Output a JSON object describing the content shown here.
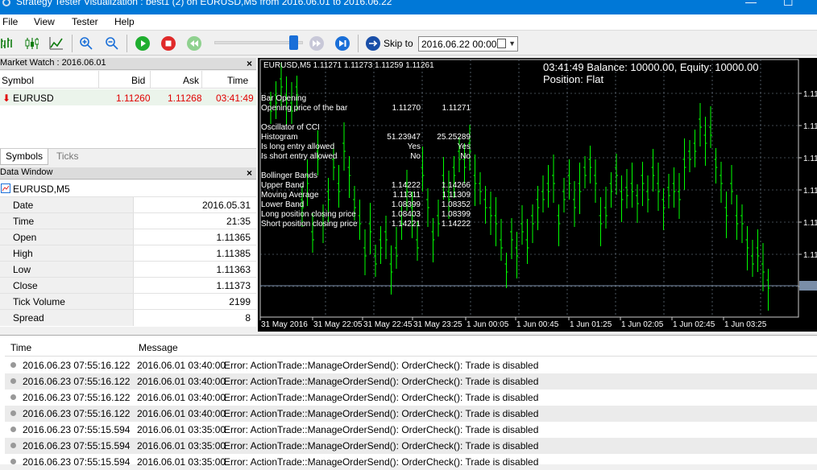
{
  "window": {
    "title": "Strategy Tester Visualization : best1 (2) on EURUSD,M5 from 2016.06.01 to 2016.06.22"
  },
  "menu": [
    "File",
    "View",
    "Tester",
    "Help"
  ],
  "toolbar": {
    "skip_label": "Skip to",
    "skip_date": "2016.06.22 00:00",
    "speed_level": 0.88
  },
  "market_watch": {
    "title": "Market Watch : 2016.06.01",
    "headers": {
      "symbol": "Symbol",
      "bid": "Bid",
      "ask": "Ask",
      "time": "Time"
    },
    "row": {
      "symbol": "EURUSD",
      "bid": "1.11260",
      "ask": "1.11268",
      "time": "03:41:49"
    },
    "tabs": [
      "Symbols",
      "Ticks"
    ]
  },
  "data_window": {
    "title": "Data Window",
    "symbol": "EURUSD,M5",
    "rows": [
      {
        "k": "Date",
        "v": "2016.05.31"
      },
      {
        "k": "Time",
        "v": "21:35"
      },
      {
        "k": "Open",
        "v": "1.11365"
      },
      {
        "k": "High",
        "v": "1.11385"
      },
      {
        "k": "Low",
        "v": "1.11363"
      },
      {
        "k": "Close",
        "v": "1.11373"
      },
      {
        "k": "Tick Volume",
        "v": "2199"
      },
      {
        "k": "Spread",
        "v": "8"
      }
    ]
  },
  "chart": {
    "header": "EURUSD,M5  1.11271 1.11273 1.11259 1.11261",
    "balance": "03:41:49 Balance: 10000.00, Equity: 10000.00",
    "position": "Position: Flat",
    "info": [
      {
        "label": "Bar Opening",
        "v1": "",
        "v2": ""
      },
      {
        "label": "Opening price of the bar",
        "v1": "1.11270",
        "v2": "1.11271"
      },
      {
        "label": "",
        "v1": "",
        "v2": ""
      },
      {
        "label": "Oscillator of CCI",
        "v1": "",
        "v2": ""
      },
      {
        "label": "Histogram",
        "v1": "51.23947",
        "v2": "25.25289"
      },
      {
        "label": "Is long entry allowed",
        "v1": "Yes",
        "v2": "Yes"
      },
      {
        "label": "Is short entry allowed",
        "v1": "No",
        "v2": "No"
      },
      {
        "label": "",
        "v1": "",
        "v2": ""
      },
      {
        "label": "Bollinger Bands",
        "v1": "",
        "v2": ""
      },
      {
        "label": "Upper Band",
        "v1": "1.14222",
        "v2": "1.14266"
      },
      {
        "label": "Moving Average",
        "v1": "1.11311",
        "v2": "1.11309"
      },
      {
        "label": "Lower Band",
        "v1": "1.08399",
        "v2": "1.08352"
      },
      {
        "label": "Long position closing price",
        "v1": "1.08403",
        "v2": "1.08399"
      },
      {
        "label": "Short position closing price",
        "v1": "1.14221",
        "v2": "1.14222"
      }
    ],
    "price_ticks": [
      "1.11",
      "1.11",
      "1.11",
      "1.11",
      "1.11",
      "1.11",
      "1.11",
      "1.11"
    ],
    "time_ticks": [
      "31 May 2016",
      "31 May 22:05",
      "31 May 22:45",
      "31 May 23:25",
      "1 Jun 00:05",
      "1 Jun 00:45",
      "1 Jun 01:25",
      "1 Jun 02:05",
      "1 Jun 02:45",
      "1 Jun 03:25"
    ],
    "colors": {
      "background": "#000000",
      "bars": "#00ff00",
      "grid": "#8090a0"
    }
  },
  "log": {
    "headers": {
      "time": "Time",
      "message": "Message"
    },
    "rows": [
      {
        "time": "2016.06.23 07:55:16.122",
        "msgtime": "2016.06.01 03:40:00",
        "msg": "Error: ActionTrade::ManageOrderSend(): OrderCheck(): Trade is disabled"
      },
      {
        "time": "2016.06.23 07:55:16.122",
        "msgtime": "2016.06.01 03:40:00",
        "msg": "Error: ActionTrade::ManageOrderSend(): OrderCheck(): Trade is disabled"
      },
      {
        "time": "2016.06.23 07:55:16.122",
        "msgtime": "2016.06.01 03:40:00",
        "msg": "Error: ActionTrade::ManageOrderSend(): OrderCheck(): Trade is disabled"
      },
      {
        "time": "2016.06.23 07:55:16.122",
        "msgtime": "2016.06.01 03:40:00",
        "msg": "Error: ActionTrade::ManageOrderSend(): OrderCheck(): Trade is disabled"
      },
      {
        "time": "2016.06.23 07:55:15.594",
        "msgtime": "2016.06.01 03:35:00",
        "msg": "Error: ActionTrade::ManageOrderSend(): OrderCheck(): Trade is disabled"
      },
      {
        "time": "2016.06.23 07:55:15.594",
        "msgtime": "2016.06.01 03:35:00",
        "msg": "Error: ActionTrade::ManageOrderSend(): OrderCheck(): Trade is disabled"
      },
      {
        "time": "2016.06.23 07:55:15.594",
        "msgtime": "2016.06.01 03:35:00",
        "msg": "Error: ActionTrade::ManageOrderSend(): OrderCheck(): Trade is disabled"
      }
    ]
  }
}
